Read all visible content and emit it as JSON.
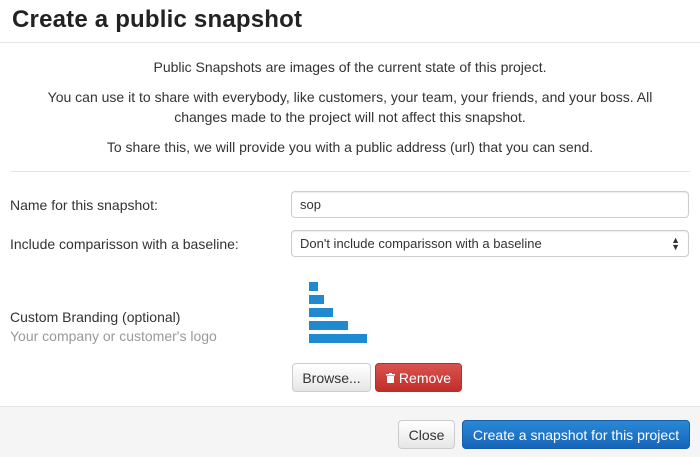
{
  "dialog": {
    "title": "Create a public snapshot",
    "intro": [
      "Public Snapshots are images of the current state of this project.",
      "You can use it to share with everybody, like customers, your team, your friends, and your boss. All changes made to the project will not affect this snapshot.",
      "To share this, we will provide you with a public address (url) that you can send."
    ]
  },
  "form": {
    "name_label": "Name for this snapshot:",
    "name_value": "sop",
    "baseline_label": "Include comparisson with a baseline:",
    "baseline_selected": "Don't include comparisson with a baseline",
    "branding_label": "Custom Branding (optional)",
    "branding_sublabel": "Your company or customer's logo",
    "browse_label": "Browse...",
    "remove_label": "Remove"
  },
  "footer": {
    "close_label": "Close",
    "create_label": "Create a snapshot for this project"
  },
  "colors": {
    "primary": "#1f6fc5",
    "danger": "#d43f3a",
    "logo_blue": "#1f8ad0"
  },
  "icons": {
    "remove": "trash-icon",
    "select": "chevron-up-down-icon",
    "logo": "bar-logo-icon"
  }
}
